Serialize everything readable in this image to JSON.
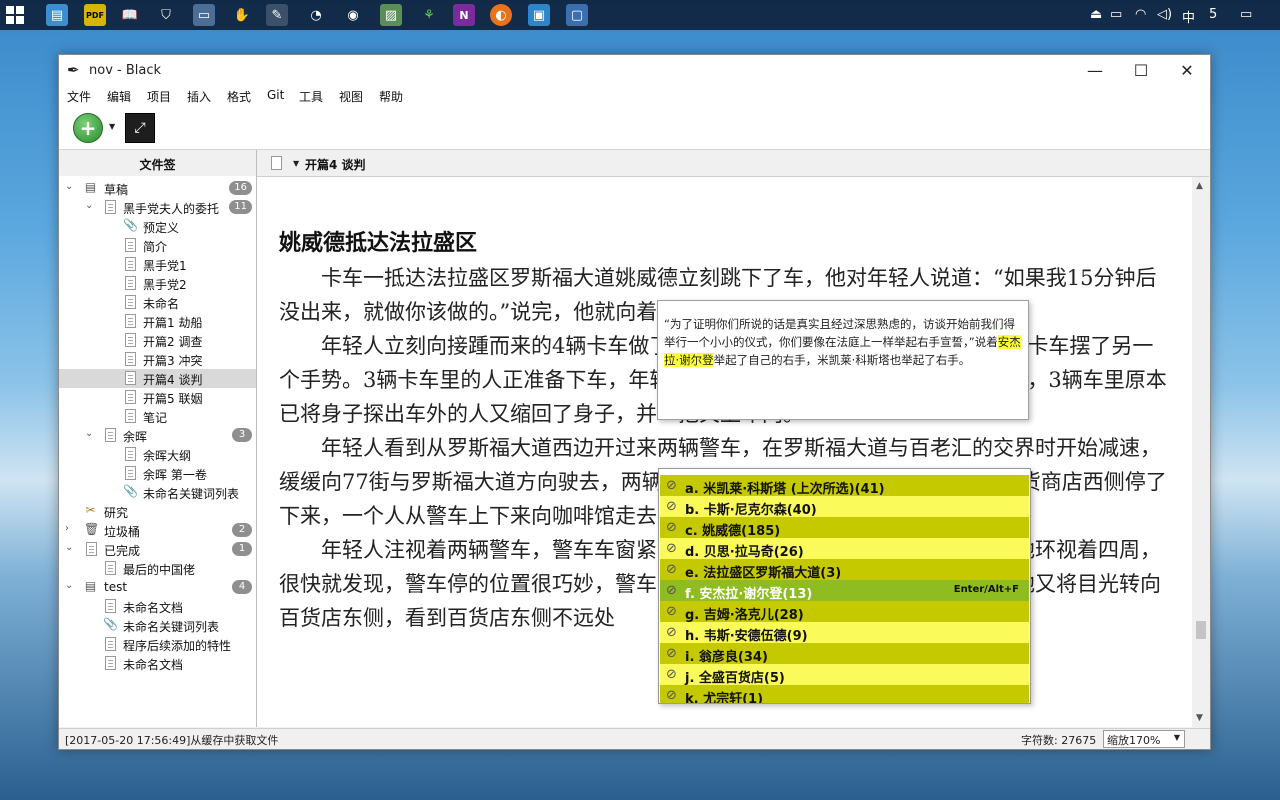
{
  "taskbar": {
    "tray_ime": "中",
    "tray_time": "5"
  },
  "window": {
    "title": "nov - Black",
    "controls": {
      "minimize": "—",
      "maximize": "☐",
      "close": "✕"
    }
  },
  "menu": {
    "file": "文件",
    "edit": "编辑",
    "project": "项目",
    "insert": "插入",
    "format": "格式",
    "git": "Git",
    "tools": "工具",
    "view": "视图",
    "help": "帮助"
  },
  "binder": {
    "header": "文件签",
    "items": [
      {
        "label": "草稿",
        "badge": "16"
      },
      {
        "label": "黑手党夫人的委托",
        "badge": "11"
      },
      {
        "label": "预定义"
      },
      {
        "label": "简介"
      },
      {
        "label": "黑手党1"
      },
      {
        "label": "黑手党2"
      },
      {
        "label": "未命名"
      },
      {
        "label": "开篇1 劫船"
      },
      {
        "label": "开篇2 调查"
      },
      {
        "label": "开篇3 冲突"
      },
      {
        "label": "开篇4 谈判"
      },
      {
        "label": "开篇5 联姻"
      },
      {
        "label": "笔记"
      },
      {
        "label": "余晖",
        "badge": "3"
      },
      {
        "label": "余晖大纲"
      },
      {
        "label": "余晖 第一卷"
      },
      {
        "label": "未命名关键词列表"
      },
      {
        "label": "研究"
      },
      {
        "label": "垃圾桶",
        "badge": "2"
      },
      {
        "label": "已完成",
        "badge": "1"
      },
      {
        "label": "最后的中国佬"
      },
      {
        "label": "test",
        "badge": "4"
      },
      {
        "label": "未命名文档"
      },
      {
        "label": "未命名关键词列表"
      },
      {
        "label": "程序后续添加的特性"
      },
      {
        "label": "未命名文档"
      }
    ]
  },
  "editor": {
    "breadcrumb": "开篇4 谈判",
    "doc_title": "姚威德抵达法拉盛区",
    "paragraphs": [
      "卡车一抵达法拉盛区罗斯福大道姚威德立刻跳下了车，他对年轻人说道：“如果我15分钟后没出来，就做你该做的。”说完，他就向着街对面的全盛百货店正门走去。",
      "年轻人立刻向接踵而来的4辆卡车做了一个手势，卡车停了下来，他向第一辆卡车摆了另一个手势。3辆卡车里的人正准备下车，年轻人马上又向三辆卡车摆出了另一个手势，3辆车里原本已将身子探出车外的人又缩回了身子，并一把关上车门。",
      "年轻人看到从罗斯福大道西边开过来两辆警车，在罗斯福大道与百老汇的交界时开始减速，缓缓向77街与罗斯福大道方向驶去，两辆警车并未开到百货店门前，而是在距百货商店西侧停了下来，一个人从警车上下来向咖啡馆走去，年轻人看到",
      "年轻人注视着两辆警车，警车车窗紧闭，无法看到车内是否还有人。他警觉地环视着四周，很快就发现，警车停的位置很巧妙，警车里的人毫不费力就能看到百货店正门。他又将目光转向百货店东侧，看到百货店东侧不远处"
    ]
  },
  "tooltip": {
    "before": "“为了证明你们所说的话是真实且经过深思熟虑的，访谈开始前我们得举行一个小小的仪式，你们要像在法庭上一样举起右手宣誓，”说着",
    "highlight": "安杰拉·谢尔登",
    "after": "举起了自己的右手，米凯莱·科斯塔也举起了右手。"
  },
  "autocomplete": {
    "shortcut": "Enter/Alt+F",
    "items": [
      {
        "label": "a. 米凯莱·科斯塔 (上次所选)(41)"
      },
      {
        "label": "b. 卡斯·尼克尔森(40)"
      },
      {
        "label": "c. 姚威德(185)"
      },
      {
        "label": "d. 贝思·拉马奇(26)"
      },
      {
        "label": "e. 法拉盛区罗斯福大道(3)"
      },
      {
        "label": "f. 安杰拉·谢尔登(13)"
      },
      {
        "label": "g. 吉姆·洛克儿(28)"
      },
      {
        "label": "h. 韦斯·安德伍德(9)"
      },
      {
        "label": "i. 翁彦良(34)"
      },
      {
        "label": "j. 全盛百货店(5)"
      },
      {
        "label": "k. 尤宗轩(1)"
      }
    ],
    "colors": {
      "dark": "#c5c900",
      "light": "#fafa5a",
      "selected": "#8fbd21"
    }
  },
  "status": {
    "message": "[2017-05-20 17:56:49]从缓存中获取文件",
    "word_count": "字符数: 27675",
    "zoom": "缩放170%"
  }
}
